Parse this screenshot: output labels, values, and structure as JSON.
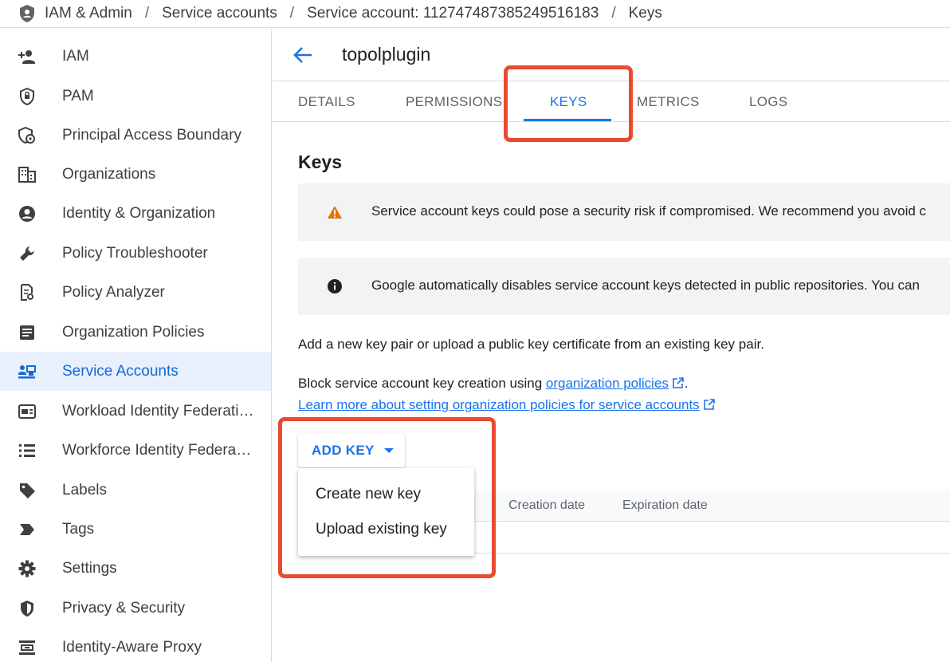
{
  "breadcrumb": {
    "items": [
      "IAM & Admin",
      "Service accounts",
      "Service account: 112747487385249516183",
      "Keys"
    ],
    "separator": "/"
  },
  "sidebar": {
    "items": [
      {
        "label": "IAM",
        "icon": "person-add-icon"
      },
      {
        "label": "PAM",
        "icon": "shield-lock-icon"
      },
      {
        "label": "Principal Access Boundary",
        "icon": "shield-gear-icon"
      },
      {
        "label": "Organizations",
        "icon": "building-icon"
      },
      {
        "label": "Identity & Organization",
        "icon": "account-circle-icon"
      },
      {
        "label": "Policy Troubleshooter",
        "icon": "wrench-icon"
      },
      {
        "label": "Policy Analyzer",
        "icon": "doc-search-icon"
      },
      {
        "label": "Organization Policies",
        "icon": "policy-doc-icon"
      },
      {
        "label": "Service Accounts",
        "icon": "service-account-icon",
        "active": true
      },
      {
        "label": "Workload Identity Federation",
        "icon": "id-card-icon"
      },
      {
        "label": "Workforce Identity Federation",
        "icon": "list-icon"
      },
      {
        "label": "Labels",
        "icon": "tag-icon"
      },
      {
        "label": "Tags",
        "icon": "chevron-tag-icon"
      },
      {
        "label": "Settings",
        "icon": "gear-icon"
      },
      {
        "label": "Privacy & Security",
        "icon": "privacy-shield-icon"
      },
      {
        "label": "Identity-Aware Proxy",
        "icon": "proxy-icon"
      }
    ]
  },
  "header": {
    "title": "topolplugin"
  },
  "tabs": [
    "DETAILS",
    "PERMISSIONS",
    "KEYS",
    "METRICS",
    "LOGS"
  ],
  "active_tab": "KEYS",
  "keys_section": {
    "heading": "Keys",
    "warning_text": "Service account keys could pose a security risk if compromised. We recommend you avoid c",
    "info_text": "Google automatically disables service account keys detected in public repositories. You can",
    "intro": "Add a new key pair or upload a public key certificate from an existing key pair.",
    "block_prefix": "Block service account key creation using ",
    "block_link": "organization policies",
    "block_suffix": ".",
    "learn_more": "Learn more about setting organization policies for service accounts"
  },
  "add_key": {
    "label": "ADD KEY",
    "menu": [
      "Create new key",
      "Upload existing key"
    ]
  },
  "table": {
    "columns": [
      "Creation date",
      "Expiration date"
    ]
  },
  "colors": {
    "accent": "#1a73e8",
    "highlight": "#ea4a2f",
    "warning": "#e37400"
  }
}
